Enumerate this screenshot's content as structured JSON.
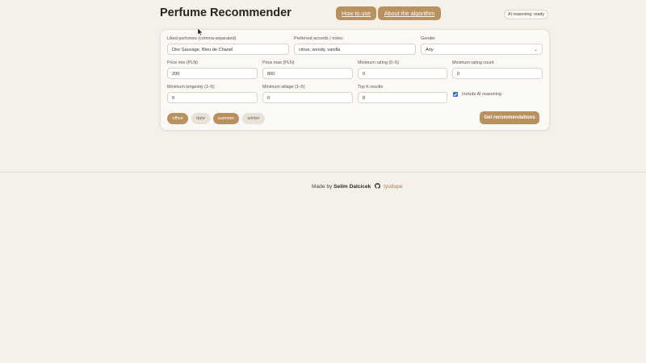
{
  "header": {
    "title": "Perfume Recommender",
    "how_to_use": "How to use",
    "about": "About the algorithm",
    "status": "AI reasoning: ready"
  },
  "form": {
    "liked": {
      "label": "Liked perfumes (comma-separated)",
      "value": "Dior Sauvage, Bleu de Chanel"
    },
    "accords": {
      "label": "Preferred accords / notes",
      "value": "citrus, woody, vanilla"
    },
    "gender": {
      "label": "Gender",
      "value": "Any"
    },
    "price_min": {
      "label": "Price min (PLN)",
      "value": "200"
    },
    "price_max": {
      "label": "Price max (PLN)",
      "value": "800"
    },
    "min_rating": {
      "label": "Minimum rating (0–5)",
      "value": "0"
    },
    "min_rating_count": {
      "label": "Minimum rating count",
      "value": "0"
    },
    "min_longevity": {
      "label": "Minimum longevity (1–5)",
      "value": "0"
    },
    "min_sillage": {
      "label": "Minimum sillage (1–5)",
      "value": "0"
    },
    "top_k": {
      "label": "Top K results",
      "value": "8"
    },
    "include_ai": {
      "label": "Include AI reasoning",
      "checked": true
    },
    "chips": [
      {
        "label": "office",
        "active": true
      },
      {
        "label": "date",
        "active": false
      },
      {
        "label": "summer",
        "active": true
      },
      {
        "label": "winter",
        "active": false
      }
    ],
    "submit": "Get recommendations"
  },
  "footer": {
    "made_by": "Made by",
    "author": "Selim Dalcicek",
    "github_icon": "github-icon",
    "username": "tyudope"
  },
  "colors": {
    "accent": "#b8915f",
    "background": "#f5f0ea",
    "card": "#fbf9f6"
  }
}
